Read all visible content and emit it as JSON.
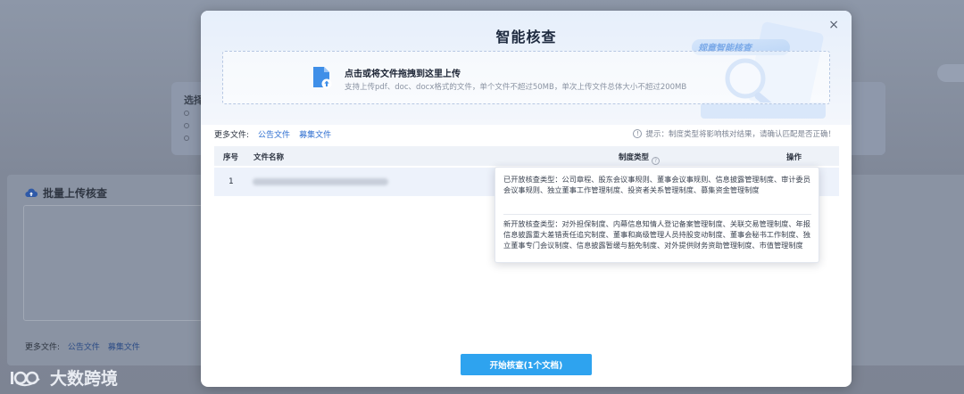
{
  "background": {
    "card_title": "选择",
    "batch_title": "批量上传核查",
    "more_label": "更多文件:",
    "more_links": [
      "公告文件",
      "募集文件"
    ],
    "watermark": "大数跨境"
  },
  "modal": {
    "title": "智能核查",
    "close_symbol": "×",
    "hero_text": "规章智能核查",
    "upload": {
      "main_text": "点击或将文件拖拽到这里上传",
      "sub_text": "支持上传pdf、doc、docx格式的文件，单个文件不超过50MB，单次上传文件总体大小不超过200MB"
    },
    "more_files": {
      "label": "更多文件:",
      "links": [
        "公告文件",
        "募集文件"
      ]
    },
    "tip": {
      "icon": "!",
      "text": "提示：制度类型将影响核对结果，请确认匹配是否正确！"
    },
    "table": {
      "headers": {
        "index": "序号",
        "file_name": "文件名称",
        "type": "制度类型",
        "action": "操作"
      },
      "rows": [
        {
          "index": "1"
        }
      ]
    },
    "popover": {
      "opened": "已开放核查类型：公司章程、股东会议事规则、董事会议事规则、信息披露管理制度、审计委员会议事规则、独立董事工作管理制度、投资者关系管理制度、募集资金管理制度",
      "new": "新开放核查类型：对外担保制度、内幕信息知情人登记备案管理制度、关联交易管理制度、年报信息披露重大差错责任追究制度、董事和高级管理人员持股变动制度、董事会秘书工作制度、独立董事专门会议制度、信息披露暂缓与豁免制度、对外提供财务资助管理制度、市值管理制度"
    },
    "start_button": "开始核查(1个文档)"
  },
  "colors": {
    "primary": "#2ea3ef",
    "link": "#2f6fd0",
    "overlay": "#808898"
  }
}
